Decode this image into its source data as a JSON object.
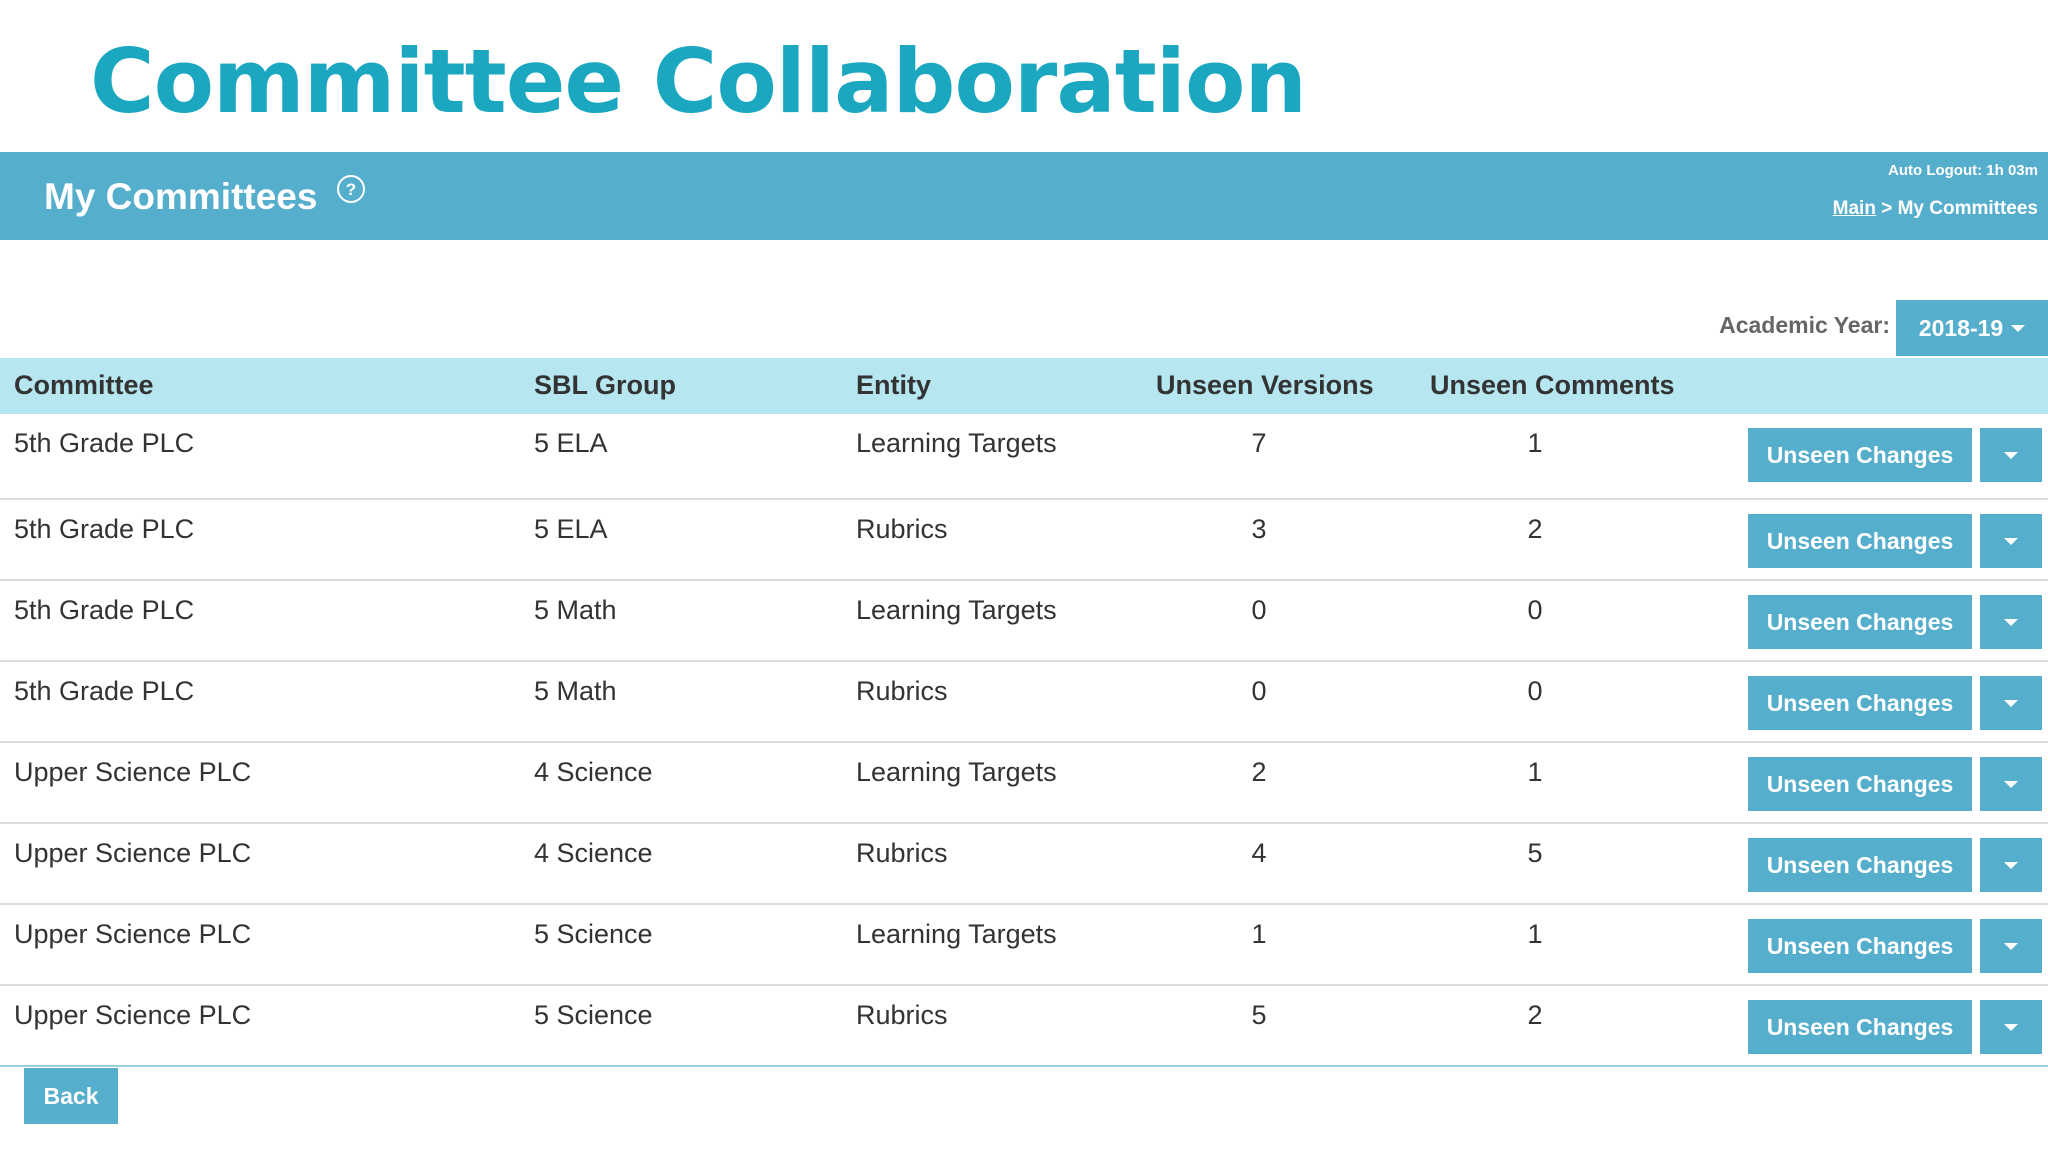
{
  "slide_title": "Committee Collaboration",
  "header": {
    "title": "My Committees",
    "help_icon": "question-circle-icon",
    "auto_logout": "Auto Logout: 1h 03m",
    "breadcrumb": {
      "link": "Main",
      "separator": " > ",
      "current": "My Committees"
    }
  },
  "academic_year": {
    "label": "Academic Year:",
    "selected": "2018-19"
  },
  "table": {
    "columns": [
      "Committee",
      "SBL Group",
      "Entity",
      "Unseen Versions",
      "Unseen Comments"
    ],
    "rows": [
      {
        "committee": "5th Grade PLC",
        "sbl_group": "5 ELA",
        "entity": "Learning Targets",
        "unseen_versions": "7",
        "unseen_comments": "1",
        "action": "Unseen Changes"
      },
      {
        "committee": "5th Grade PLC",
        "sbl_group": "5 ELA",
        "entity": "Rubrics",
        "unseen_versions": "3",
        "unseen_comments": "2",
        "action": "Unseen Changes"
      },
      {
        "committee": "5th Grade PLC",
        "sbl_group": "5 Math",
        "entity": "Learning Targets",
        "unseen_versions": "0",
        "unseen_comments": "0",
        "action": "Unseen Changes"
      },
      {
        "committee": "5th Grade PLC",
        "sbl_group": "5 Math",
        "entity": "Rubrics",
        "unseen_versions": "0",
        "unseen_comments": "0",
        "action": "Unseen Changes"
      },
      {
        "committee": "Upper Science PLC",
        "sbl_group": "4 Science",
        "entity": "Learning Targets",
        "unseen_versions": "2",
        "unseen_comments": "1",
        "action": "Unseen Changes"
      },
      {
        "committee": "Upper Science PLC",
        "sbl_group": "4 Science",
        "entity": "Rubrics",
        "unseen_versions": "4",
        "unseen_comments": "5",
        "action": "Unseen Changes"
      },
      {
        "committee": "Upper Science PLC",
        "sbl_group": "5 Science",
        "entity": "Learning Targets",
        "unseen_versions": "1",
        "unseen_comments": "1",
        "action": "Unseen Changes"
      },
      {
        "committee": "Upper Science PLC",
        "sbl_group": "5 Science",
        "entity": "Rubrics",
        "unseen_versions": "5",
        "unseen_comments": "2",
        "action": "Unseen Changes"
      }
    ]
  },
  "back_label": "Back",
  "colors": {
    "title": "#1aa7bf",
    "header_bar": "#56aecd",
    "table_header": "#b6e6f0",
    "button": "#56aecd"
  }
}
